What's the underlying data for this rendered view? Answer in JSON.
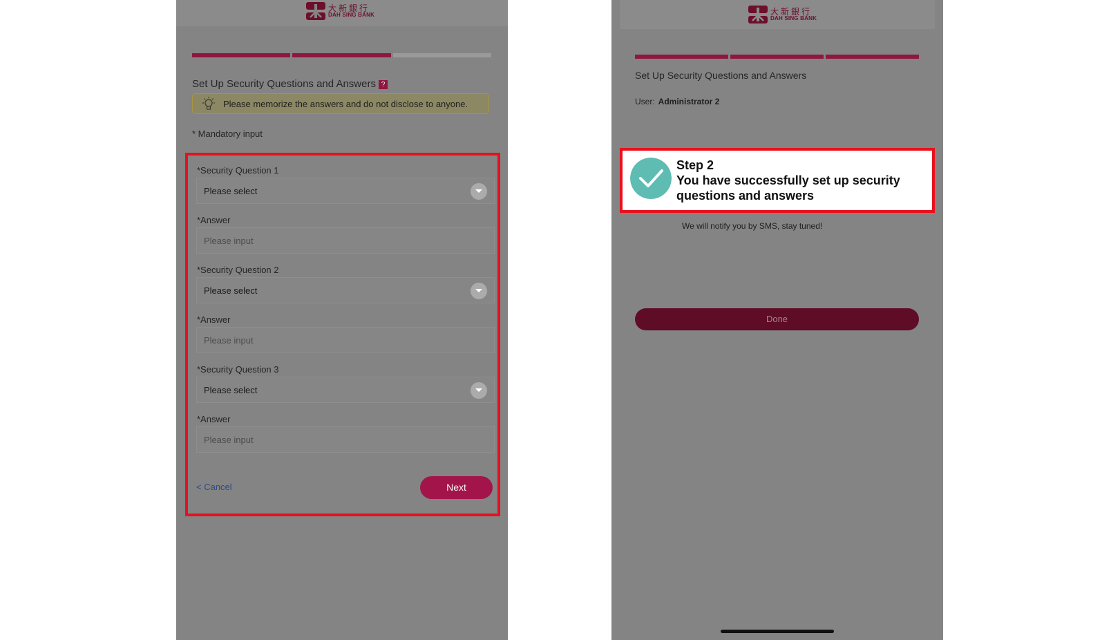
{
  "colors": {
    "brand": "#6d0f2b",
    "progress_active": "#8f1641",
    "progress_inactive": "#9a9a9a",
    "button": "#a3154a",
    "done_button": "#5f0c26",
    "success_check": "#5ebcb3",
    "highlight": "#e8101c"
  },
  "logo": {
    "cn": "大新銀行",
    "en": "DAH SING BANK"
  },
  "left": {
    "progress": [
      "done",
      "done",
      "pending"
    ],
    "title": "Set Up Security Questions and Answers",
    "help_glyph": "?",
    "notice": "Please memorize the answers and do not disclose to anyone.",
    "mandatory": "* Mandatory input",
    "form": {
      "q1_label": "*Security Question 1",
      "q1_value": "Please select",
      "a1_label": "*Answer",
      "a1_placeholder": "Please input",
      "q2_label": "*Security Question 2",
      "q2_value": "Please select",
      "a2_label": "*Answer",
      "a2_placeholder": "Please input",
      "q3_label": "*Security Question 3",
      "q3_value": "Please select",
      "a3_label": "*Answer",
      "a3_placeholder": "Please input",
      "cancel": "< Cancel",
      "next": "Next"
    }
  },
  "right": {
    "progress": [
      "done",
      "done",
      "done"
    ],
    "title": "Set Up Security Questions and Answers",
    "user_label": "User:",
    "user_name": "Administrator 2",
    "step": "Step 2",
    "success": "You have successfully set up security questions and answers",
    "notify": "We will notify you by SMS, stay tuned!",
    "done": "Done"
  },
  "icons": [
    "bank-logo-icon",
    "help-icon",
    "lightbulb-icon",
    "dropdown-chevron-icon",
    "checkmark-icon"
  ]
}
